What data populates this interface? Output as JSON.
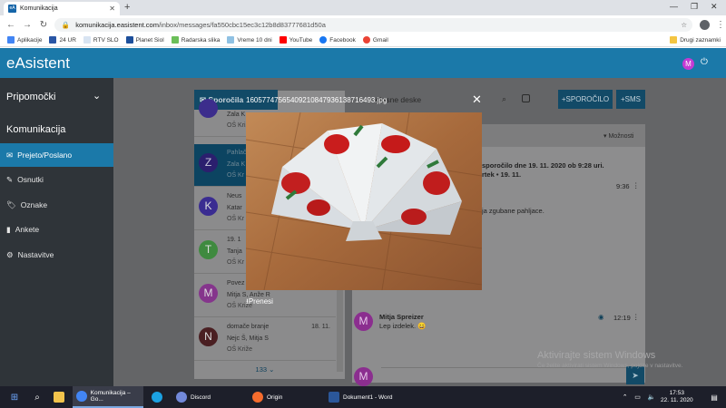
{
  "browser": {
    "tab_title": "Komunikacija",
    "favicon": "eA",
    "url_domain": "komunikacija.easistent.com",
    "url_path": "/inbox/messages/fa550cbc15ec3c12b8d83777681d50a",
    "bookmarks": [
      "Aplikacije",
      "24 UR",
      "RTV SLO",
      "Planet Siol",
      "Radarska slika",
      "Vreme 10 dni",
      "YouTube",
      "Facebook",
      "Gmail"
    ],
    "other_bookmarks": "Drugi zaznamki"
  },
  "app": {
    "brand": "eAsistent",
    "user_initial": "M",
    "accent_color": "#1b79a9"
  },
  "sidebar": {
    "tools_heading": "Pripomočki",
    "section_heading": "Komunikacija",
    "items": [
      {
        "label": "Prejeto/Poslano",
        "icon": "inbox-icon"
      },
      {
        "label": "Osnutki",
        "icon": "pencil-icon"
      },
      {
        "label": "Oznake",
        "icon": "tag-icon"
      },
      {
        "label": "Ankete",
        "icon": "chart-icon"
      },
      {
        "label": "Nastavitve",
        "icon": "gear-icon"
      }
    ]
  },
  "list": {
    "header": "Sporočila",
    "messages": [
      {
        "initial": "",
        "line1": "Zala K",
        "line2": "",
        "line3": "OŠ Križe",
        "date": ""
      },
      {
        "initial": "Z",
        "line1": "Pahlač",
        "line2": "Zala K",
        "line3": "OŠ Kr",
        "date": ""
      },
      {
        "initial": "K",
        "line1": "Neus",
        "line2": "Katar",
        "line3": "OŠ Kr",
        "date": ""
      },
      {
        "initial": "T",
        "line1": "19. 1",
        "line2": "Tanja",
        "line3": "OŠ Kr",
        "date": ""
      },
      {
        "initial": "M",
        "line1": "Povez",
        "line2": "Mitja S, Anže R",
        "line3": "OŠ Križe",
        "date": ""
      },
      {
        "initial": "N",
        "line1": "domače branje",
        "line2": "Nejc Š, Mitja S",
        "line3": "OŠ Križe",
        "date": "18. 11."
      }
    ],
    "more_count": "133"
  },
  "detail": {
    "header_partial": "glasne deske",
    "options": "Možnosti",
    "new_message_btn": "SPOROČILO",
    "sms_btn": "SMS",
    "info_line1": "sporočilo dne 19. 11. 2020 ob 9:28 uri.",
    "info_line2": "rtek • 19. 11.",
    "time1": "9:36",
    "body_partial": "ja zgubane pahljace.",
    "reply_author": "Mitja Spreizer",
    "reply_text": "Lep izdelek.",
    "reply_time": "12:19",
    "reply_initial": "M"
  },
  "lightbox": {
    "filename": "16057747565409210847936138716493.jpg",
    "download_label": "Prenesi"
  },
  "watermark": {
    "line1": "Aktivirajte sistem Windows",
    "line2": "Če želite aktivirati sistem Windows, pojdite v nastavitve."
  },
  "taskbar": {
    "items": [
      "Komunikacija – Go...",
      "Discord",
      "Origin",
      "Dokument1 - Word"
    ],
    "time": "17:53",
    "date": "22. 11. 2020"
  }
}
